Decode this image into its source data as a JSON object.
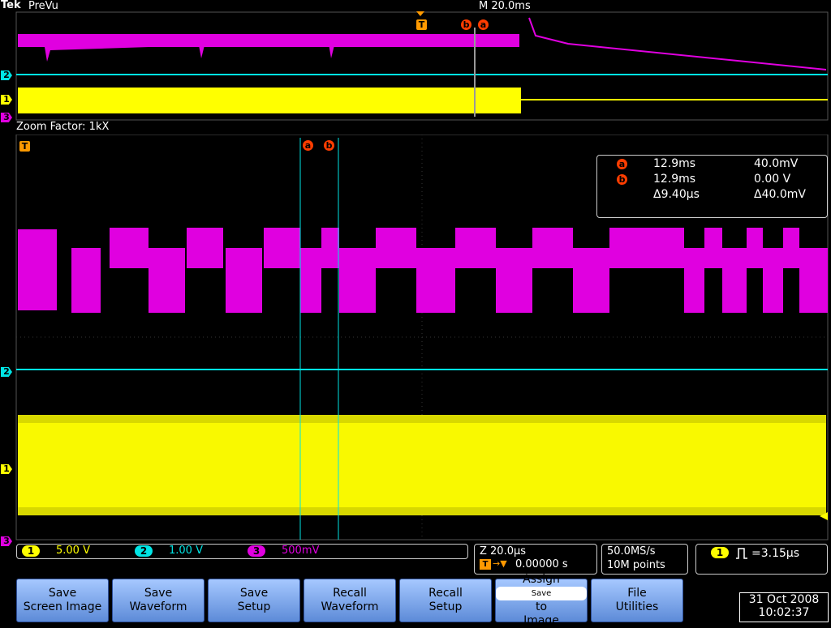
{
  "header": {
    "brand": "Tek",
    "mode": "PreVu",
    "timebase": "M 20.0ms"
  },
  "preview": {
    "trigger_marker": "T",
    "cursor_b": "b",
    "cursor_a": "a"
  },
  "zoom": {
    "label": "Zoom Factor: 1kX",
    "trigger_marker": "T",
    "cursor_a": "a",
    "cursor_b": "b"
  },
  "channels": {
    "ch1": {
      "label": "1",
      "color": "#ffff00"
    },
    "ch2": {
      "label": "2",
      "color": "#00e5e5"
    },
    "ch3": {
      "label": "3",
      "color": "#e000e0"
    }
  },
  "readout": {
    "a": {
      "label": "a",
      "time": "12.9ms",
      "volt": "40.0mV"
    },
    "b": {
      "label": "b",
      "time": "12.9ms",
      "volt": "0.00 V"
    },
    "delta": {
      "time": "Δ9.40µs",
      "volt": "Δ40.0mV"
    }
  },
  "status": {
    "ch1": {
      "label": "1",
      "scale": "5.00 V"
    },
    "ch2": {
      "label": "2",
      "scale": "1.00 V"
    },
    "ch3": {
      "label": "3",
      "scale": "500mV"
    }
  },
  "zoom_info": {
    "z": "Z 20.0µs",
    "trigger_pos_icon": "T",
    "trigger_pos": "0.00000 s"
  },
  "acquisition": {
    "rate": "50.0MS/s",
    "points": "10M points"
  },
  "trigger_info": {
    "source": "1",
    "icon": "pulse-icon",
    "value": "=3.15µs"
  },
  "buttons": [
    {
      "line1": "Save",
      "line2": "Screen Image"
    },
    {
      "line1": "Save",
      "line2": "Waveform"
    },
    {
      "line1": "Save",
      "line2": "Setup"
    },
    {
      "line1": "Recall",
      "line2": "Waveform"
    },
    {
      "line1": "Recall",
      "line2": "Setup"
    },
    {
      "line1": "Assign",
      "pill": "Save",
      "line2": "to",
      "line3": "Image"
    },
    {
      "line1": "File",
      "line2": "Utilities"
    }
  ],
  "datetime": {
    "date": "31 Oct  2008",
    "time": "10:02:37"
  }
}
